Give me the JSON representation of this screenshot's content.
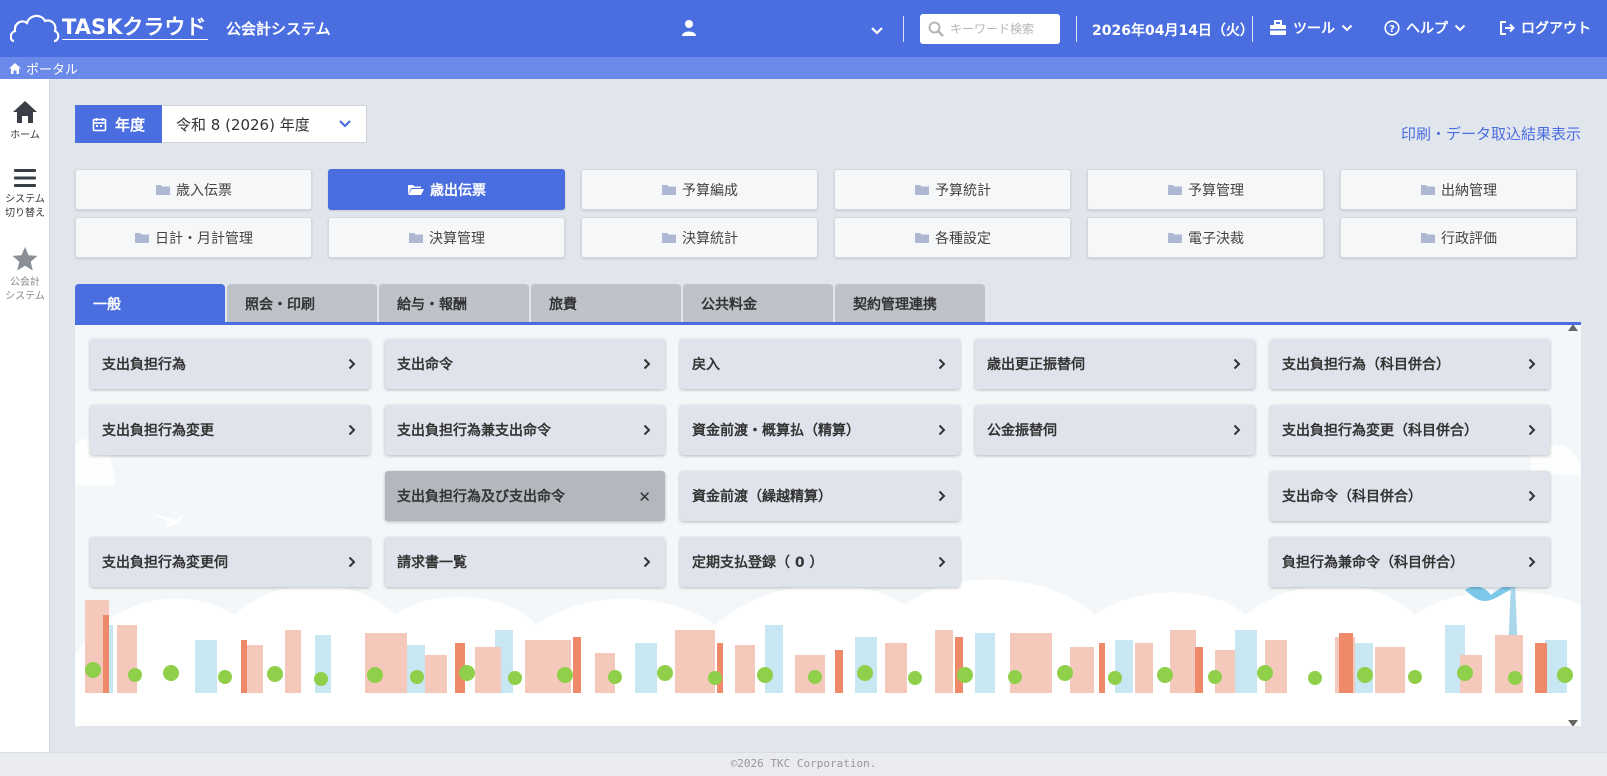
{
  "header": {
    "logo_text": "TASKクラウド",
    "system_name": "公会計システム",
    "search_placeholder": "キーワード検索",
    "date": "2026年04月14日（火）",
    "tools_label": "ツール",
    "help_label": "ヘルプ",
    "logout_label": "ログアウト",
    "colors": {
      "primary": "#4a6ee0",
      "subbar": "#6b89e8"
    }
  },
  "breadcrumb": {
    "label": "ポータル"
  },
  "leftrail": {
    "home": "ホーム",
    "switch_line1": "システム",
    "switch_line2": "切り替え",
    "system_line1": "公会計",
    "system_line2": "システム"
  },
  "year": {
    "badge": "年度",
    "value": "令和 8 (2026) 年度"
  },
  "print_link": "印刷・データ取込結果表示",
  "categories": [
    {
      "label": "歳入伝票",
      "active": false
    },
    {
      "label": "歳出伝票",
      "active": true
    },
    {
      "label": "予算編成",
      "active": false
    },
    {
      "label": "予算統計",
      "active": false
    },
    {
      "label": "予算管理",
      "active": false
    },
    {
      "label": "出納管理",
      "active": false
    },
    {
      "label": "日計・月計管理",
      "active": false
    },
    {
      "label": "決算管理",
      "active": false
    },
    {
      "label": "決算統計",
      "active": false
    },
    {
      "label": "各種設定",
      "active": false
    },
    {
      "label": "電子決裁",
      "active": false
    },
    {
      "label": "行政評価",
      "active": false
    }
  ],
  "tabs": [
    "一般",
    "照会・印刷",
    "給与・報酬",
    "旅費",
    "公共料金",
    "契約管理連携"
  ],
  "functions": {
    "col1": [
      "支出負担行為",
      "支出負担行為変更",
      "",
      "支出負担行為変更伺"
    ],
    "col2": [
      "支出命令",
      "支出負担行為兼支出命令",
      "支出負担行為及び支出命令",
      "請求書一覧"
    ],
    "col3": [
      "戻入",
      "資金前渡・概算払（精算）",
      "資金前渡（繰越精算）",
      "定期支払登録（ 0 ）"
    ],
    "col4": [
      "歳出更正振替伺",
      "公金振替伺",
      "",
      ""
    ],
    "col5": [
      "支出負担行為（科目併合）",
      "支出負担行為変更（科目併合）",
      "支出命令（科目併合）",
      "負担行為兼命令（科目併合）"
    ]
  },
  "footer": "©2026 TKC Corporation."
}
